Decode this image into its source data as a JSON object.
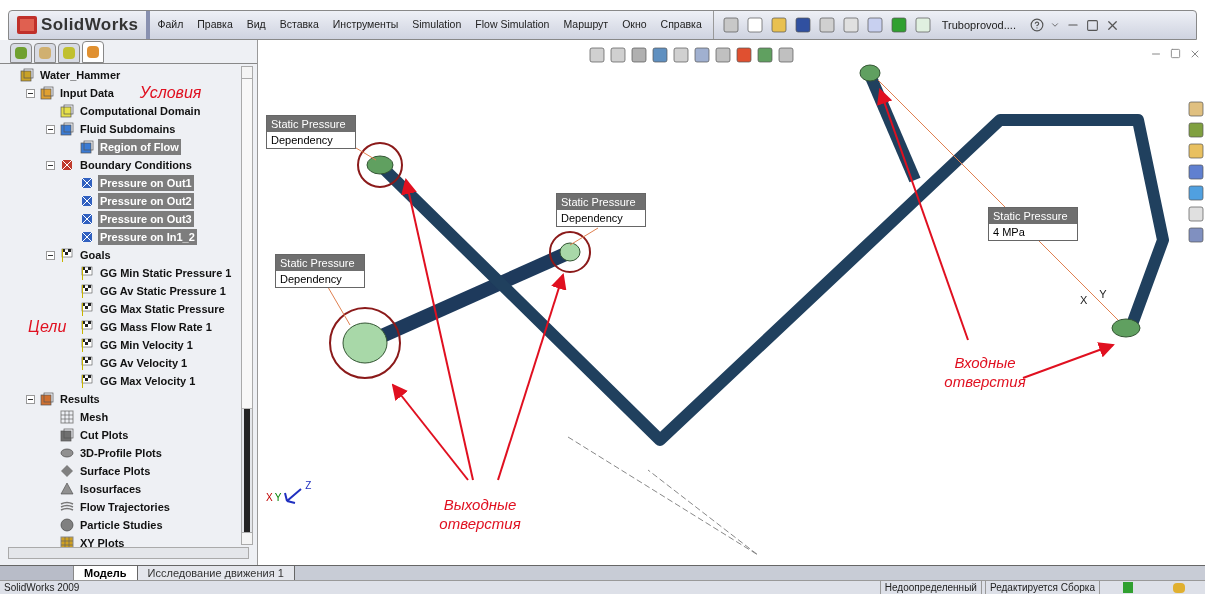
{
  "app": {
    "logo_text": "SolidWorks",
    "document_title": "Truboprovod...."
  },
  "menu": [
    "Файл",
    "Правка",
    "Вид",
    "Вставка",
    "Инструменты",
    "Simulation",
    "Flow Simulation",
    "Маршрут",
    "Окно",
    "Справка"
  ],
  "panel_tabs": [
    {
      "kind": "parts",
      "selected": false
    },
    {
      "kind": "properties",
      "selected": false
    },
    {
      "kind": "config",
      "selected": false
    },
    {
      "kind": "flow",
      "selected": true
    }
  ],
  "tree": [
    {
      "label": "Water_Hammer",
      "kind": "assembly",
      "selected": false,
      "children": [
        {
          "label": "Input Data",
          "kind": "folder",
          "selected": false,
          "expanded": true,
          "note": "Условия",
          "children": [
            {
              "label": "Computational Domain",
              "kind": "domain",
              "selected": false
            },
            {
              "label": "Fluid Subdomains",
              "kind": "fluid",
              "selected": false,
              "expanded": true,
              "children": [
                {
                  "label": "Region of Flow",
                  "kind": "region",
                  "selected": true
                }
              ]
            },
            {
              "label": "Boundary Conditions",
              "kind": "boundary",
              "selected": false,
              "expanded": true,
              "children": [
                {
                  "label": "Pressure on Out1",
                  "kind": "pressure",
                  "selected": true
                },
                {
                  "label": "Pressure on Out2",
                  "kind": "pressure",
                  "selected": true
                },
                {
                  "label": "Pressure on Out3",
                  "kind": "pressure",
                  "selected": true
                },
                {
                  "label": "Pressure on In1_2",
                  "kind": "pressure",
                  "selected": true
                }
              ]
            },
            {
              "label": "Goals",
              "kind": "goal",
              "selected": false,
              "expanded": true,
              "children": [
                {
                  "label": "GG Min Static Pressure 1",
                  "kind": "goal",
                  "selected": false
                },
                {
                  "label": "GG Av Static Pressure 1",
                  "kind": "goal",
                  "selected": false
                },
                {
                  "label": "GG Max Static Pressure",
                  "kind": "goal",
                  "selected": false
                },
                {
                  "label": "GG Mass Flow Rate 1",
                  "kind": "goal",
                  "selected": false,
                  "note": "Цели"
                },
                {
                  "label": "GG Min Velocity 1",
                  "kind": "goal",
                  "selected": false
                },
                {
                  "label": "GG Av Velocity 1",
                  "kind": "goal",
                  "selected": false
                },
                {
                  "label": "GG Max Velocity 1",
                  "kind": "goal",
                  "selected": false
                }
              ]
            }
          ]
        },
        {
          "label": "Results",
          "kind": "results",
          "selected": false,
          "expanded": true,
          "children": [
            {
              "label": "Mesh",
              "kind": "mesh",
              "selected": false
            },
            {
              "label": "Cut Plots",
              "kind": "cut",
              "selected": false
            },
            {
              "label": "3D-Profile Plots",
              "kind": "profile",
              "selected": false
            },
            {
              "label": "Surface Plots",
              "kind": "surface",
              "selected": false
            },
            {
              "label": "Isosurfaces",
              "kind": "iso",
              "selected": false
            },
            {
              "label": "Flow Trajectories",
              "kind": "trajectory",
              "selected": false
            },
            {
              "label": "Particle Studies",
              "kind": "particle",
              "selected": false
            },
            {
              "label": "XY Plots",
              "kind": "xy",
              "selected": false
            }
          ]
        }
      ]
    }
  ],
  "viewport": {
    "callouts": [
      {
        "title": "Static Pressure",
        "value": "Dependency"
      },
      {
        "title": "Static Pressure",
        "value": "Dependency"
      },
      {
        "title": "Static Pressure",
        "value": "Dependency"
      },
      {
        "title": "Static Pressure",
        "value": "4 MPa"
      }
    ],
    "annotations": [
      "Выходные отверстия",
      "Входные отверстия"
    ],
    "triad_axes": [
      "X",
      "Y",
      "Z"
    ],
    "part_axes": [
      "X",
      "Y"
    ]
  },
  "bottom_tabs": [
    {
      "label": "Модель",
      "selected": true
    },
    {
      "label": "Исследование движения 1",
      "selected": false
    }
  ],
  "status_bar": {
    "app": "SolidWorks 2009",
    "fields": [
      "Недоопределенный",
      "Редактируется Сборка"
    ]
  }
}
